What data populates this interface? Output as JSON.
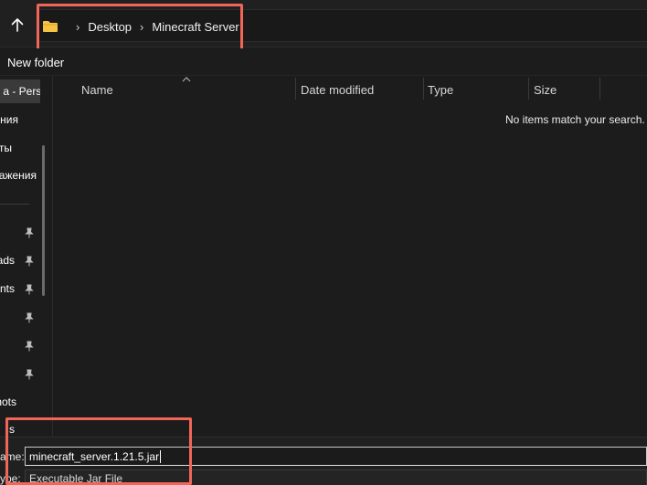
{
  "nav": {
    "up_icon": "arrow-up-icon"
  },
  "breadcrumb": {
    "folder_icon": "folder-icon",
    "items": [
      "Desktop",
      "Minecraft Server"
    ]
  },
  "toolbar": {
    "new_folder_label": "New folder"
  },
  "sidebar": {
    "items": [
      {
        "label": "a - Perso",
        "selected": true
      },
      {
        "label": "ния"
      },
      {
        "label": "енты"
      },
      {
        "label": "ажения"
      },
      {
        "label": "",
        "pinned": true
      },
      {
        "label": "ads",
        "pinned": true
      },
      {
        "label": "ents",
        "pinned": true
      },
      {
        "label": "",
        "pinned": true
      },
      {
        "label": "",
        "pinned": true
      },
      {
        "label": "",
        "pinned": true
      },
      {
        "label": "hots"
      },
      {
        "label": "s"
      }
    ]
  },
  "columns": [
    "Name",
    "Date modified",
    "Type",
    "Size"
  ],
  "content": {
    "empty_message": "No items match your search."
  },
  "footer": {
    "filename_label": "ame:",
    "filename_value": "minecraft_server.1.21.5.jar",
    "filetype_label": "ype:",
    "filetype_value": "Executable Jar File"
  },
  "colors": {
    "highlight": "#f2665a",
    "folder": "#f5c244",
    "background": "#1c1c1c"
  }
}
